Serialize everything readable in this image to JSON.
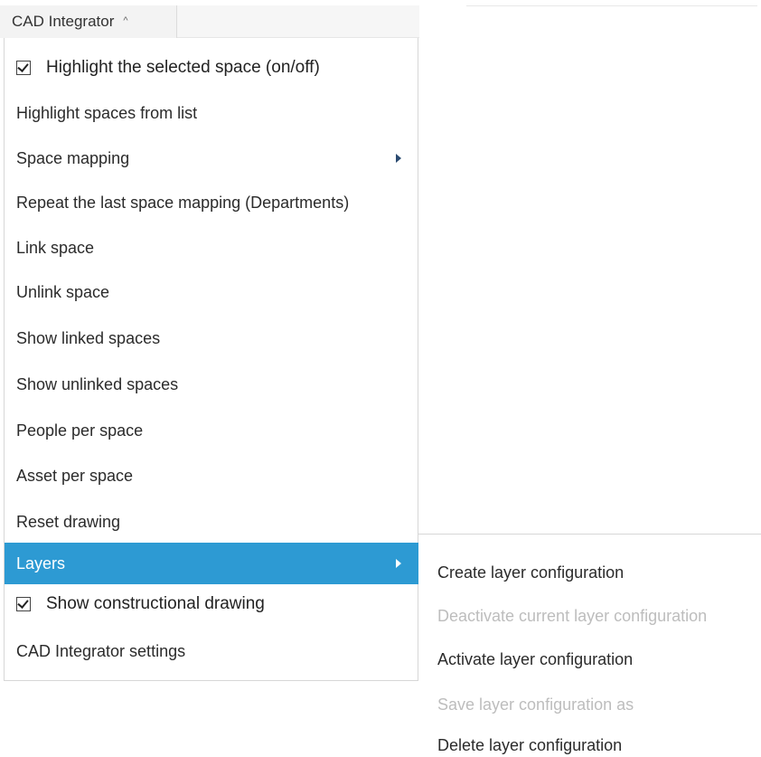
{
  "toolbar": {
    "title": "CAD Integrator",
    "chevron": "^"
  },
  "menu": {
    "highlight_selected": "Highlight the selected space (on/off)",
    "highlight_list": "Highlight spaces from list",
    "space_mapping": "Space mapping",
    "repeat_mapping": "Repeat the last space mapping (Departments)",
    "link_space": "Link space",
    "unlink_space": "Unlink space",
    "show_linked": "Show linked spaces",
    "show_unlinked": "Show unlinked spaces",
    "people_per_space": "People per space",
    "asset_per_space": "Asset per space",
    "reset_drawing": "Reset drawing",
    "layers": "Layers",
    "show_constructional": "Show constructional drawing",
    "settings": "CAD Integrator settings"
  },
  "submenu": {
    "create": "Create layer configuration",
    "deactivate": "Deactivate current layer configuration",
    "activate": "Activate layer configuration",
    "save_as": "Save layer configuration as",
    "delete": "Delete layer configuration"
  },
  "colors": {
    "active_item_bg": "#2d9ad3",
    "disabled_text": "#bdbdbd",
    "submenu_arrow": "#2a4a70"
  },
  "icons": {
    "toolbar_chevron": "chevron-up-icon",
    "submenu_arrow": "caret-right-icon",
    "checkbox": "checkbox-checked-icon"
  }
}
